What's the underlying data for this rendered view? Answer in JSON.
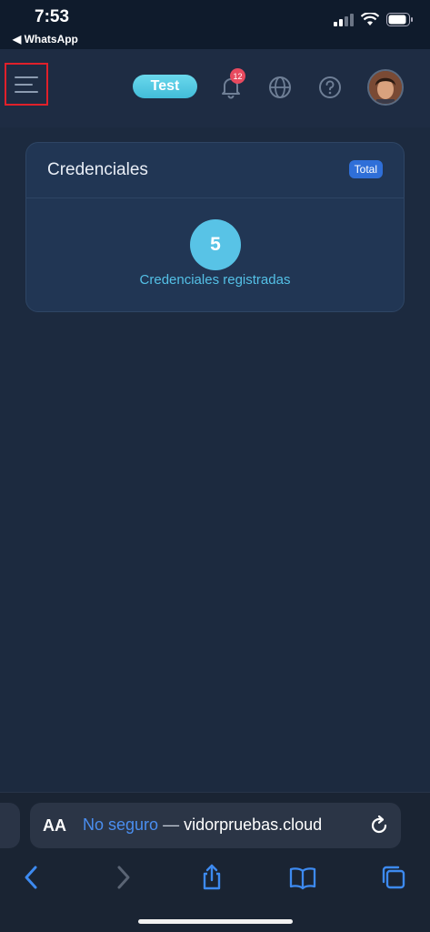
{
  "status_bar": {
    "time": "7:53",
    "back_app": "◀ WhatsApp",
    "icons": [
      "cellular-signal-icon",
      "wifi-icon",
      "battery-icon"
    ]
  },
  "header": {
    "menu_icon": "hamburger-menu-icon",
    "env_badge": "Test",
    "notifications_count": "12",
    "icons": [
      "bell-icon",
      "globe-icon",
      "help-icon",
      "avatar"
    ]
  },
  "card": {
    "title": "Credenciales",
    "badge": "Total",
    "count": "5",
    "count_label": "Credenciales registradas"
  },
  "safari": {
    "aa_label": "AA",
    "url_insecure": "No seguro",
    "url_sep": " — ",
    "url_host": "vidorpruebas.cloud",
    "toolbar_icons": [
      "back-icon",
      "forward-icon",
      "share-icon",
      "bookmarks-icon",
      "tabs-icon"
    ]
  },
  "colors": {
    "background": "#1c2a3f",
    "accent": "#58c3e6",
    "badge_blue": "#2f6fd8",
    "notification_red": "#e84a5f",
    "highlight_red": "#e0202a"
  }
}
